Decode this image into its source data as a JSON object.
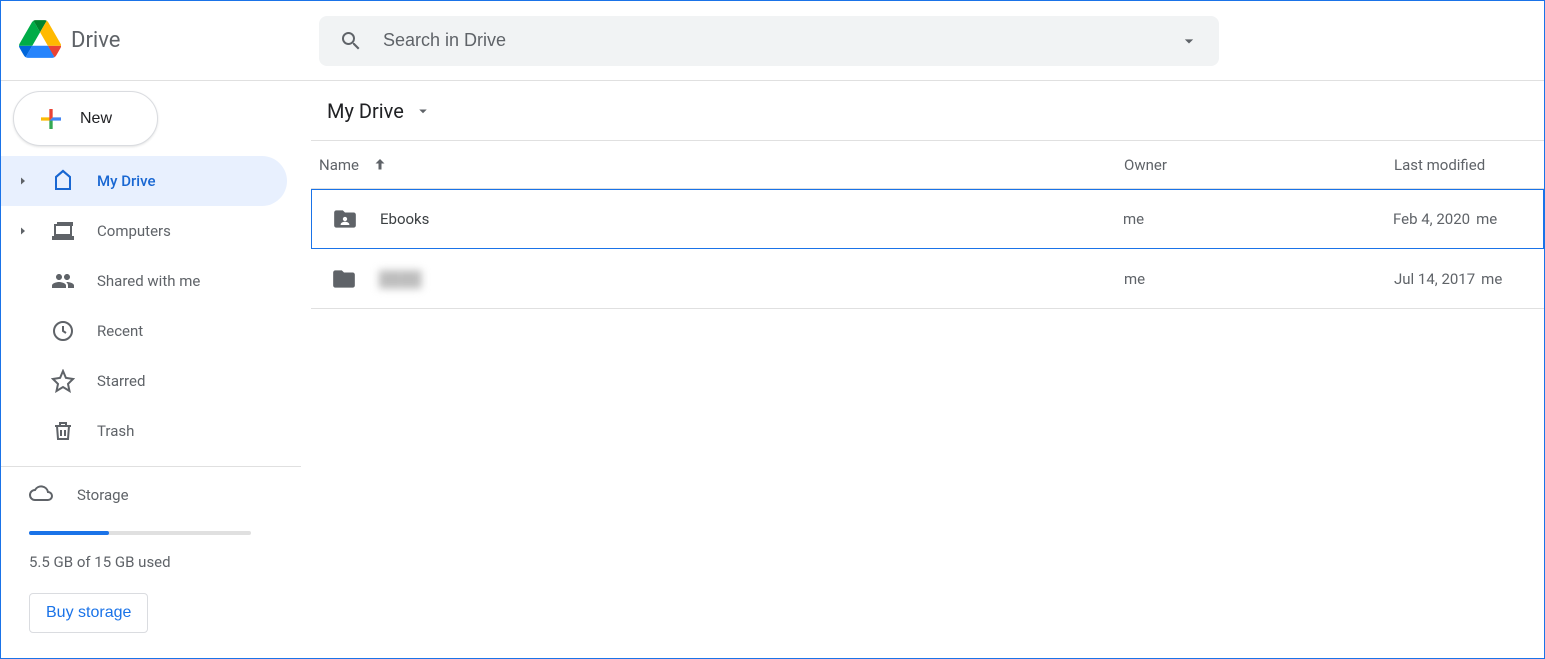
{
  "header": {
    "app_name": "Drive",
    "search_placeholder": "Search in Drive"
  },
  "sidebar": {
    "new_label": "New",
    "items": [
      {
        "label": "My Drive"
      },
      {
        "label": "Computers"
      },
      {
        "label": "Shared with me"
      },
      {
        "label": "Recent"
      },
      {
        "label": "Starred"
      },
      {
        "label": "Trash"
      }
    ],
    "storage": {
      "label": "Storage",
      "used_text": "5.5 GB of 15 GB used",
      "buy_label": "Buy storage",
      "percent": 36
    }
  },
  "main": {
    "breadcrumb": "My Drive",
    "columns": {
      "name": "Name",
      "owner": "Owner",
      "modified": "Last modified"
    },
    "rows": [
      {
        "name": "Ebooks",
        "owner": "me",
        "modified": "Feb 4, 2020",
        "modified_by": "me",
        "shared": true,
        "selected": true
      },
      {
        "name": "",
        "owner": "me",
        "modified": "Jul 14, 2017",
        "modified_by": "me",
        "shared": false,
        "selected": false,
        "redacted": true
      }
    ]
  }
}
